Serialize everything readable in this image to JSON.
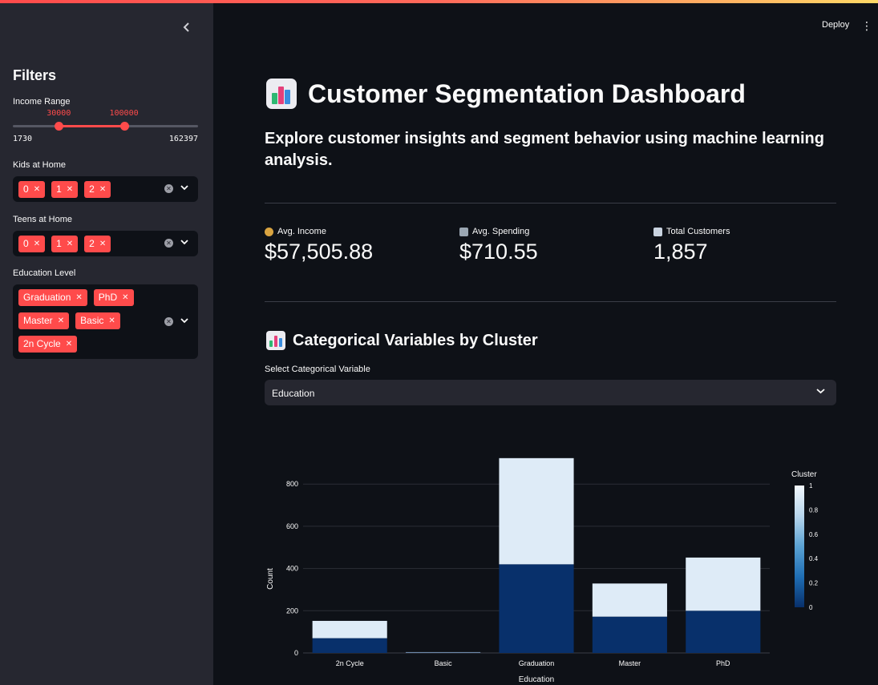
{
  "sidebar": {
    "collapse_icon": "chevron-left-icon",
    "title": "Filters",
    "income": {
      "label": "Income Range",
      "min": 1730,
      "max": 162397,
      "low": 30000,
      "high": 100000,
      "min_text": "1730",
      "max_text": "162397",
      "low_text": "30000",
      "high_text": "100000"
    },
    "kids": {
      "label": "Kids at Home",
      "selected": [
        "0",
        "1",
        "2"
      ]
    },
    "teens": {
      "label": "Teens at Home",
      "selected": [
        "0",
        "1",
        "2"
      ]
    },
    "education": {
      "label": "Education Level",
      "selected": [
        "Graduation",
        "PhD",
        "Master",
        "Basic",
        "2n Cycle"
      ]
    }
  },
  "header": {
    "deploy_label": "Deploy",
    "menu_icon": "kebab-menu-icon"
  },
  "main": {
    "title": "Customer Segmentation Dashboard",
    "subtitle": "Explore customer insights and segment behavior using machine learning analysis.",
    "metrics": [
      {
        "icon": "money-bag-icon",
        "label": "Avg. Income",
        "value": "$57,505.88"
      },
      {
        "icon": "shopping-cart-icon",
        "label": "Avg. Spending",
        "value": "$710.55"
      },
      {
        "icon": "trend-chart-icon",
        "label": "Total Customers",
        "value": "1,857"
      }
    ],
    "section_title": "Categorical Variables by Cluster",
    "select_label": "Select Categorical Variable",
    "select_value": "Education"
  },
  "colors": {
    "accent": "#ff4b4b",
    "cluster0": "#08306b",
    "cluster1": "#deebf7"
  },
  "chart_data": {
    "type": "bar",
    "stacked": true,
    "xlabel": "Education",
    "ylabel": "Count",
    "categories": [
      "2n Cycle",
      "Basic",
      "Graduation",
      "Master",
      "PhD"
    ],
    "series": [
      {
        "name": "0",
        "values": [
          70,
          2,
          420,
          172,
          200
        ]
      },
      {
        "name": "1",
        "values": [
          82,
          2,
          503,
          157,
          252
        ]
      }
    ],
    "ylim": [
      0,
      930
    ],
    "yticks": [
      0,
      200,
      400,
      600,
      800
    ],
    "colorbar": {
      "title": "Cluster",
      "ticks": [
        "0",
        "0.2",
        "0.4",
        "0.6",
        "0.8",
        "1"
      ]
    },
    "grid": true
  }
}
